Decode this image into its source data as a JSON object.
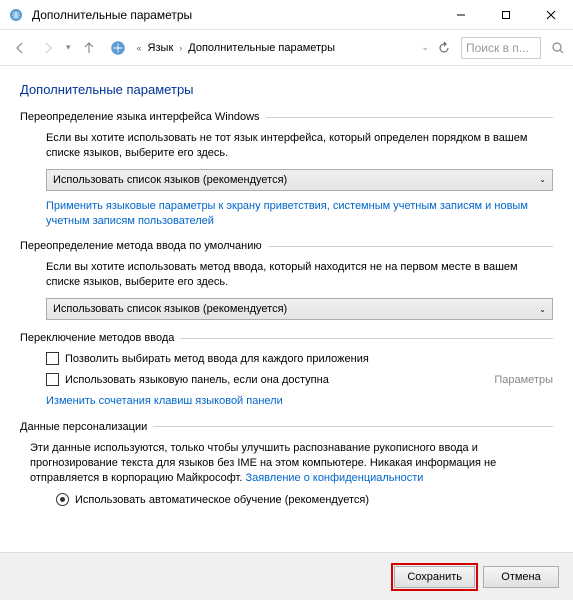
{
  "titlebar": {
    "title": "Дополнительные параметры"
  },
  "breadcrumb": {
    "lang": "Язык",
    "page": "Дополнительные параметры"
  },
  "search": {
    "placeholder": "Поиск в п..."
  },
  "page": {
    "title": "Дополнительные параметры"
  },
  "section1": {
    "header": "Переопределение языка интерфейса Windows",
    "desc": "Если вы хотите использовать не тот язык интерфейса, который определен порядком в вашем списке языков, выберите его здесь.",
    "dropdown": "Использовать список языков (рекомендуется)",
    "link": "Применить языковые параметры к экрану приветствия, системным учетным записям и новым учетным записям пользователей"
  },
  "section2": {
    "header": "Переопределение метода ввода по умолчанию",
    "desc": "Если вы хотите использовать метод ввода, который находится не на первом месте в вашем списке языков, выберите его здесь.",
    "dropdown": "Использовать список языков (рекомендуется)"
  },
  "section3": {
    "header": "Переключение методов ввода",
    "check1": "Позволить выбирать метод ввода для каждого приложения",
    "check2": "Использовать языковую панель, если она доступна",
    "paramsLink": "Параметры",
    "link": "Изменить сочетания клавиш языковой панели"
  },
  "section4": {
    "header": "Данные персонализации",
    "desc": "Эти данные используются, только чтобы улучшить распознавание рукописного ввода и прогнозирование текста для языков без IME на этом компьютере. Никакая информация не отправляется в корпорацию Майкрософт. ",
    "privacyLink": "Заявление о конфиденциальности",
    "radio1": "Использовать автоматическое обучение (рекомендуется)"
  },
  "footer": {
    "save": "Сохранить",
    "cancel": "Отмена"
  }
}
